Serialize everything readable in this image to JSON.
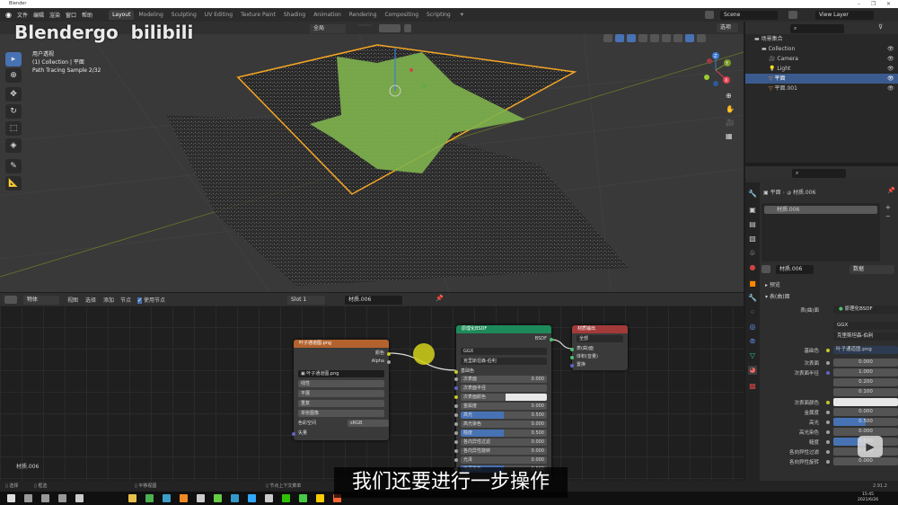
{
  "window": {
    "title": "Blender",
    "min": "–",
    "max": "❐",
    "close": "✕"
  },
  "menu": {
    "items": [
      "文件",
      "编辑",
      "渲染",
      "窗口",
      "帮助"
    ],
    "tabs": [
      "Layout",
      "Modeling",
      "Sculpting",
      "UV Editing",
      "Texture Paint",
      "Shading",
      "Animation",
      "Rendering",
      "Compositing",
      "Scripting"
    ],
    "active_tab": "Layout",
    "add": "+"
  },
  "scene": {
    "scene_name": "Scene",
    "view_layer": "View Layer"
  },
  "watermark": {
    "logo": "Blendergo",
    "site": "bilibili"
  },
  "viewport": {
    "orientation": "全局",
    "options": "选项",
    "info": [
      "用户透视",
      "(1) Collection | 平面",
      "Path Tracing Sample 2/32"
    ],
    "toolbar_icons": [
      "select-box-icon",
      "cursor-icon",
      "move-icon",
      "rotate-icon",
      "scale-icon",
      "transform-icon",
      "annotate-icon",
      "measure-icon"
    ],
    "gizmo": {
      "x": "X",
      "y": "Y",
      "z": "Z"
    }
  },
  "outliner": {
    "root": "场景集合",
    "items": [
      {
        "name": "Collection",
        "type": "collection",
        "selected": false
      },
      {
        "name": "Camera",
        "type": "camera",
        "selected": false
      },
      {
        "name": "Light",
        "type": "light",
        "selected": false
      },
      {
        "name": "平面",
        "type": "mesh",
        "selected": true
      },
      {
        "name": "平面.001",
        "type": "mesh",
        "selected": false
      }
    ]
  },
  "properties": {
    "object": "平面",
    "material": "材质.006",
    "slot_item": "材质.006",
    "material_field": "材质.006",
    "link": "数据",
    "panels": {
      "preview": "预览",
      "surface": "表(曲)面"
    },
    "surface_label": "表(曲)面",
    "surface_value": "原理化BSDF",
    "distribution": "GGX",
    "subsurface_method": "克里斯坦森-伯利",
    "base_color_label": "基础色",
    "base_color_value": "叶子通道图.png",
    "rows": [
      {
        "label": "次表面",
        "value": "0.000",
        "fill": 0
      },
      {
        "label": "次表面半径",
        "value": "1.000",
        "fill": 0
      },
      {
        "label": "",
        "value": "0.200",
        "fill": 0
      },
      {
        "label": "",
        "value": "0.100",
        "fill": 0
      },
      {
        "label": "次表面颜色",
        "value": "",
        "fill": 0,
        "color": "#e8e8e8"
      },
      {
        "label": "金属度",
        "value": "0.000",
        "fill": 0
      },
      {
        "label": "高光",
        "value": "0.500",
        "fill": 0.5
      },
      {
        "label": "高光染色",
        "value": "0.000",
        "fill": 0
      },
      {
        "label": "糙度",
        "value": "0.500",
        "fill": 0.5
      },
      {
        "label": "各向异性过滤",
        "value": "0.000",
        "fill": 0
      },
      {
        "label": "各向异性旋转",
        "value": "0.000",
        "fill": 0
      }
    ]
  },
  "node_editor": {
    "object_mode": "物体",
    "menus": [
      "视图",
      "选择",
      "添加",
      "节点"
    ],
    "use_nodes": "使用节点",
    "slot": "Slot 1",
    "material": "材质.006",
    "material_label": "材质.006",
    "image_node": {
      "title": "叶子通道图.png",
      "outputs": [
        "颜色",
        "Alpha"
      ],
      "image": "叶子通道图.png",
      "interpolation": "线性",
      "projection": "平展",
      "extension": "重复",
      "source": "单张图像",
      "colorspace_label": "色彩空间",
      "colorspace": "sRGB",
      "input": "矢量"
    },
    "bsdf_node": {
      "title": "原理化BSDF",
      "output": "BSDF",
      "distribution": "GGX",
      "subsurface_method": "克里斯坦森-伯利",
      "base_color": "基础色",
      "rows": [
        {
          "label": "次表面",
          "value": "0.000",
          "fill": 0
        },
        {
          "label": "次表面半径",
          "value": "",
          "fill": 0
        },
        {
          "label": "次表面颜色",
          "value": "",
          "fill": 0,
          "color": "#e8e8e8"
        },
        {
          "label": "金属度",
          "value": "0.000",
          "fill": 0
        },
        {
          "label": "高光",
          "value": "0.500",
          "fill": 0.5
        },
        {
          "label": "高光染色",
          "value": "0.000",
          "fill": 0
        },
        {
          "label": "糙度",
          "value": "0.500",
          "fill": 0.5
        },
        {
          "label": "各向异性过滤",
          "value": "0.000",
          "fill": 0
        },
        {
          "label": "各向异性旋转",
          "value": "0.000",
          "fill": 0
        },
        {
          "label": "光泽",
          "value": "0.000",
          "fill": 0
        },
        {
          "label": "光泽染色",
          "value": "0.500",
          "fill": 0.5
        }
      ]
    },
    "output_node": {
      "title": "材质输出",
      "target": "全部",
      "inputs": [
        "表(曲)面",
        "体积(音量)",
        "置换"
      ]
    }
  },
  "status": {
    "select": "选择",
    "box": "框选",
    "pan": "平移视图",
    "context": "节点上下文菜单",
    "version": "2.91.2"
  },
  "subtitle": "我们还要进行一步操作",
  "clock": {
    "time": "15:45",
    "date": "2021/6/26"
  },
  "colors": {
    "accent": "#4772b3",
    "selection_outline": "#f5a623",
    "image_node_header": "#b3622e",
    "bsdf_node_header": "#1d8a5a",
    "output_node_header": "#a33a3a",
    "socket_color": "#c7c729",
    "socket_shader": "#4cc26c",
    "socket_vector": "#6363c7"
  },
  "taskbar_icons": [
    "windows-icon",
    "search-icon",
    "cortana-icon",
    "taskview-icon",
    "app-icon",
    "explorer-icon",
    "chrome-icon",
    "app-icon",
    "blender-icon",
    "notepad-icon",
    "app-icon",
    "app-icon",
    "photoshop-icon",
    "app-icon",
    "wechat-icon",
    "app-icon",
    "app-icon",
    "app-icon"
  ]
}
